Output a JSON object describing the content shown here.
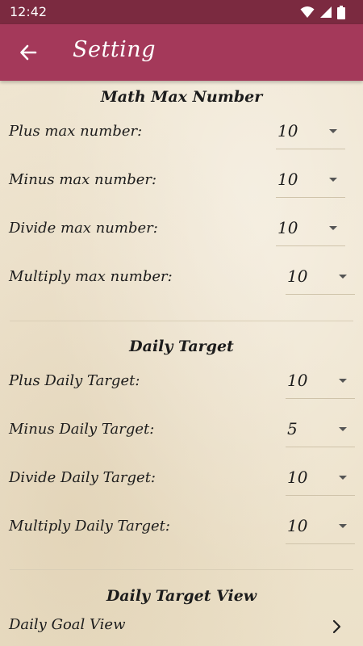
{
  "status_bar": {
    "time": "12:42"
  },
  "app_bar": {
    "title": "Setting"
  },
  "sections": {
    "max_number": {
      "title": "Math Max Number",
      "rows": [
        {
          "label": "Plus max number:",
          "value": "10"
        },
        {
          "label": "Minus max number:",
          "value": "10"
        },
        {
          "label": "Divide max number:",
          "value": "10"
        },
        {
          "label": "Multiply max number:",
          "value": "10"
        }
      ]
    },
    "daily_target": {
      "title": "Daily Target",
      "rows": [
        {
          "label": "Plus Daily Target:",
          "value": "10"
        },
        {
          "label": "Minus Daily Target:",
          "value": "5"
        },
        {
          "label": "Divide Daily Target:",
          "value": "10"
        },
        {
          "label": "Multiply Daily Target:",
          "value": "10"
        }
      ]
    },
    "daily_target_view": {
      "title": "Daily Target View",
      "item_label": "Daily Goal View"
    }
  },
  "colors": {
    "status_bar": "#7b2a40",
    "app_bar": "#a4395a",
    "background": "#eee4cf"
  },
  "icons": {
    "back": "arrow-left-icon",
    "dropdown": "dropdown-arrow-icon",
    "chevron": "chevron-right-icon",
    "wifi": "wifi-icon",
    "signal": "signal-icon",
    "battery": "battery-icon"
  }
}
